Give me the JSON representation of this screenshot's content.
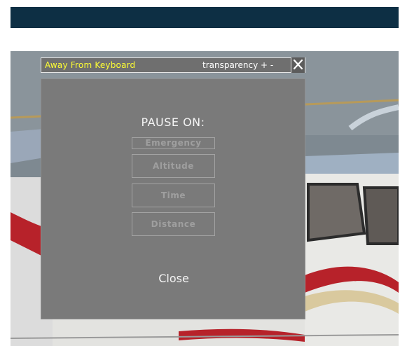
{
  "dialog": {
    "title": "Away From Keyboard",
    "transparency_label": "transparency + -",
    "heading": "PAUSE ON:",
    "options": [
      {
        "label": "Emergency"
      },
      {
        "label": "Altitude"
      },
      {
        "label": "Time"
      },
      {
        "label": "Distance"
      }
    ],
    "close_label": "Close"
  },
  "colors": {
    "topbar": "#0d2f44",
    "title_text": "#ffff33",
    "panel_bg": "#7a7a7a"
  }
}
